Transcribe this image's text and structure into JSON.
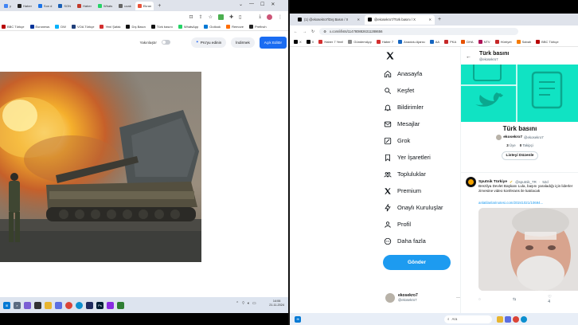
{
  "left_window": {
    "tabs": [
      {
        "label": "y",
        "color": "#4285f4"
      },
      {
        "label": "Haber",
        "color": "#222222"
      },
      {
        "label": "Son d",
        "color": "#1a73e8"
      },
      {
        "label": "SON",
        "color": "#1a5fb4"
      },
      {
        "label": "Haber",
        "color": "#c0392b"
      },
      {
        "label": "Whats",
        "color": "#25d366"
      },
      {
        "label": "ucak",
        "color": "#666666"
      },
      {
        "label": "Ekran",
        "color": "#e8533a"
      }
    ],
    "bookmarks": [
      "BBC Türkçe",
      "Euronews",
      "DW",
      "VOA Türkçe",
      "Yeni Şafak",
      "Dış Basın",
      "Türk basını",
      "WhatsApp",
      "Outlook",
      "Remove",
      "Prefinch"
    ],
    "toolbar": {
      "toggle_label": "Yakınlaştır",
      "pro_label": "Pro'yu edinin",
      "download_label": "İndirmek",
      "edit_label": "Açık Editör"
    },
    "taskbar": {
      "time": "14:06",
      "date": "21.11.2024"
    }
  },
  "right_window": {
    "tabs": [
      {
        "label": "(1) @ekosekro7/Dış Basın / X"
      },
      {
        "label": "@ekosekro7/Türk basını / X"
      }
    ],
    "url": "x.com/i/lists/1147808826311288656",
    "bookmarks": [
      "X",
      "X",
      "Haber 7 Yeni!",
      "GündemApp",
      "Haber 7",
      "Anadolu Ajansı",
      "AA",
      "PKA",
      "DHA",
      "NTV",
      "Hürriyet",
      "Sabah",
      "BBC Türkçe"
    ],
    "nav": [
      {
        "label": "Anasayfa",
        "icon": "home-icon"
      },
      {
        "label": "Keşfet",
        "icon": "search-icon"
      },
      {
        "label": "Bildirimler",
        "icon": "bell-icon"
      },
      {
        "label": "Mesajlar",
        "icon": "mail-icon"
      },
      {
        "label": "Grok",
        "icon": "grok-icon"
      },
      {
        "label": "Yer İşaretleri",
        "icon": "bookmark-icon"
      },
      {
        "label": "Topluluklar",
        "icon": "communities-icon"
      },
      {
        "label": "Premium",
        "icon": "x-logo-icon"
      },
      {
        "label": "Onaylı Kuruluşlar",
        "icon": "lightning-icon"
      },
      {
        "label": "Profil",
        "icon": "person-icon"
      },
      {
        "label": "Daha fazla",
        "icon": "more-icon"
      }
    ],
    "post_button": "Gönder",
    "account": {
      "name": "ekosekro7",
      "handle": "@ekosekro7"
    },
    "list": {
      "header_title": "Türk basını",
      "header_handle": "@ekosekro7",
      "title": "Türk basını",
      "owner_name": "ekosekro7",
      "owner_handle": "@ekosekro7",
      "members_count": "3",
      "members_label": "Üye",
      "followers_count": "0",
      "followers_label": "Takipçi",
      "edit_button": "Listeyi Düzenle"
    },
    "tweet": {
      "author": "Sputnik Türkiye",
      "handle": "@sputnik_TR",
      "time": "52d",
      "text": "Brezilya Devlet Başkanı Lula, başını yaraladığı için liderler zirvesine video konferans ile katılacak",
      "link": "anlatilanlarinotesi.com/20241021/10694...",
      "likes": "4"
    },
    "taskbar": {
      "search_placeholder": "Ara"
    },
    "colors": {
      "accent": "#1d9bf0",
      "banner": "#10e3c3"
    }
  }
}
